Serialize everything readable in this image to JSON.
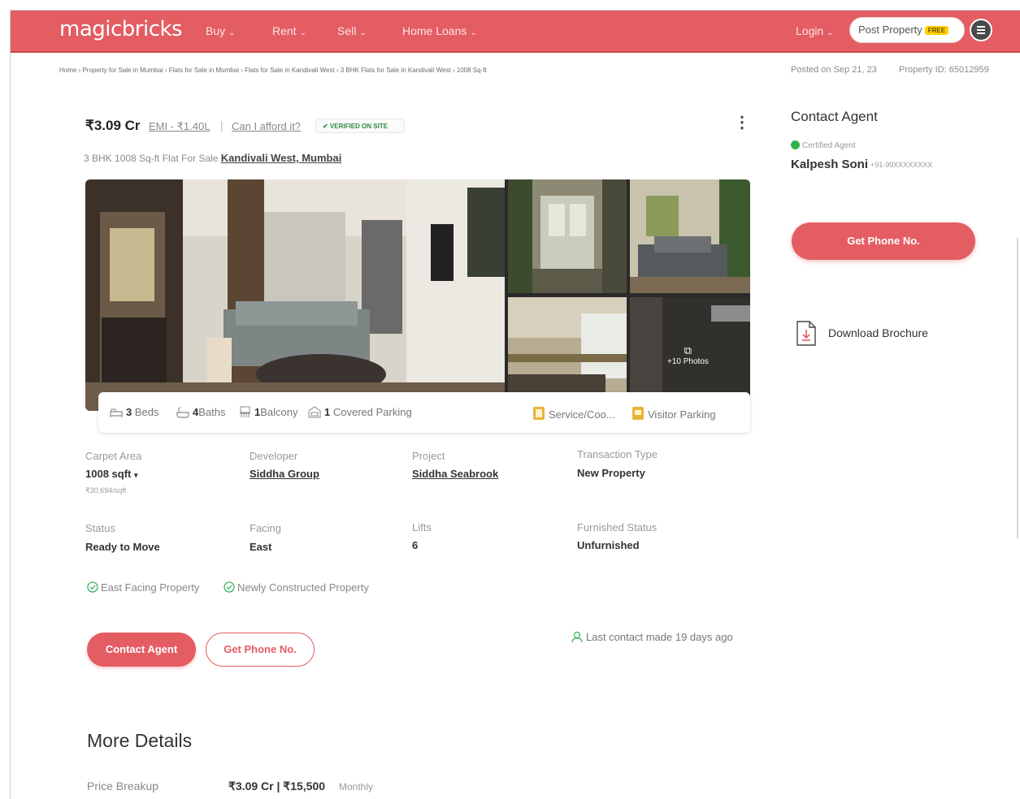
{
  "header": {
    "logo": "magicbricks",
    "nav": [
      {
        "label": "Buy"
      },
      {
        "label": "Rent"
      },
      {
        "label": "Sell"
      },
      {
        "label": "Home Loans"
      }
    ],
    "login": "Login",
    "post_property": "Post Property",
    "free_tag": "FREE"
  },
  "breadcrumb": "Home › Property for Sale in Mumbai › Flats for Sale in Mumbai › Flats for Sale in Kandivali West › 3 BHK Flats for Sale in Kandivali West › 1008 Sq-ft",
  "meta": {
    "posted": "Posted on Sep 21, 23",
    "property_id": "Property ID: 65012959"
  },
  "listing": {
    "price": "₹3.09 Cr",
    "emi": "EMI - ₹1.40L",
    "afford": "Can I afford it?",
    "verified": "✔ VERIFIED ON SITE",
    "subtitle": "3 BHK 1008 Sq-ft Flat For Sale",
    "location": "Kandivali West, Mumbai",
    "photo_count": "+10 Photos"
  },
  "amenities": {
    "beds_num": "3",
    "beds": "Beds",
    "baths_num": "4",
    "baths": "Baths",
    "balcony_num": "1",
    "balcony": "Balcony",
    "parking_num": "1",
    "parking": "Covered Parking",
    "service": "Service/Coo...",
    "visitor": "Visitor Parking"
  },
  "summary": {
    "carpet_label": "Carpet Area",
    "carpet_value": "1008 sqft",
    "carpet_rate": "₹30,694/sqft",
    "developer_label": "Developer",
    "developer_value": "Siddha Group",
    "project_label": "Project",
    "project_value": "Siddha Seabrook",
    "transaction_label": "Transaction Type",
    "transaction_value": "New Property",
    "status_label": "Status",
    "status_value": "Ready to Move",
    "facing_label": "Facing",
    "facing_value": "East",
    "lifts_label": "Lifts",
    "lifts_value": "6",
    "furnished_label": "Furnished Status",
    "furnished_value": "Unfurnished"
  },
  "tags": [
    "East Facing Property",
    "Newly Constructed Property"
  ],
  "actions": {
    "contact_agent": "Contact Agent",
    "get_phone": "Get Phone No.",
    "last_contact": "Last contact made 19 days ago"
  },
  "more_details": {
    "title": "More Details",
    "price_breakup_label": "Price Breakup",
    "price_breakup_value": "₹3.09 Cr | ₹15,500",
    "price_breakup_suffix": "Monthly"
  },
  "agent": {
    "title": "Contact Agent",
    "certified": "Certified Agent",
    "name": "Kalpesh Soni",
    "phone": "+91-99XXXXXXXX",
    "get_phone": "Get Phone No.",
    "download": "Download Brochure"
  },
  "colors": {
    "brand": "#e35d63",
    "verified": "#2e8b3e",
    "certified": "#2fb24c"
  }
}
